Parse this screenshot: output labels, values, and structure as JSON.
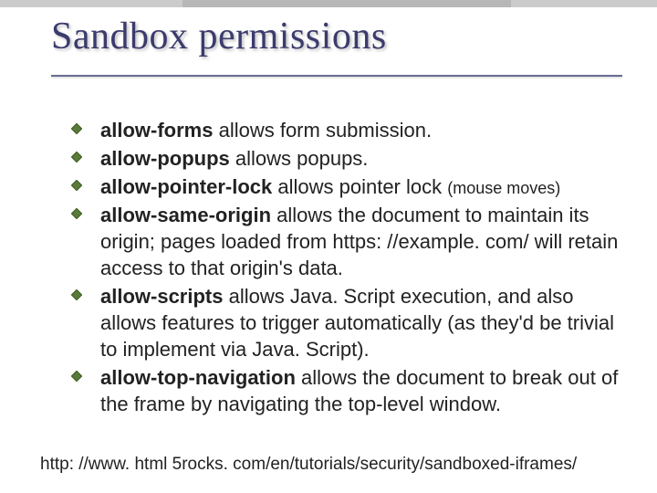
{
  "title": "Sandbox permissions",
  "items": [
    {
      "term": "allow-forms",
      "desc": " allows form submission."
    },
    {
      "term": "allow-popups",
      "desc": " allows popups."
    },
    {
      "term": "allow-pointer-lock",
      "desc": " allows pointer lock",
      "note": "(mouse moves)"
    },
    {
      "term": "allow-same-origin",
      "desc": " allows the document to maintain its origin; pages loaded from https: //example. com/ will retain access to that origin's data."
    },
    {
      "term": "allow-scripts",
      "desc": " allows Java. Script execution, and also allows features to trigger automatically (as they'd be trivial to implement via Java. Script)."
    },
    {
      "term": "allow-top-navigation",
      "desc": " allows the document to break out of the frame by navigating the top-level window."
    }
  ],
  "footer": "http: //www. html 5rocks. com/en/tutorials/security/sandboxed-iframes/"
}
